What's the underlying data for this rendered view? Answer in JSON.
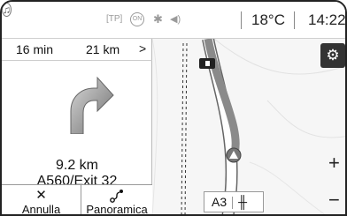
{
  "status_bar": {
    "tp_label": "[TP]",
    "on_label": "ON",
    "icons": [
      "tp-indicator-icon",
      "on-indicator-icon",
      "bluetooth-icon",
      "volume-icon",
      "music-icon"
    ],
    "temperature": "18°C",
    "time": "14:22"
  },
  "route_panel": {
    "eta_time": "16 min",
    "eta_distance": "21 km",
    "eta_chevron": ">",
    "maneuver_icon": "turn-right-icon",
    "next_distance": "9.2 km",
    "next_road": "A560/Exit 32",
    "list_icon": "list-icon"
  },
  "buttons": {
    "cancel_glyph": "✕",
    "cancel_label": "Annulla",
    "overview_label": "Panoramica"
  },
  "map": {
    "settings_icon": "gear-icon",
    "zoom_in": "+",
    "zoom_out": "−",
    "road_name": "A3",
    "road_icon": "road-icon"
  },
  "colors": {
    "settings_bg": "#333333",
    "route_fill": "#888888",
    "map_bg": "#f6f6f6"
  }
}
